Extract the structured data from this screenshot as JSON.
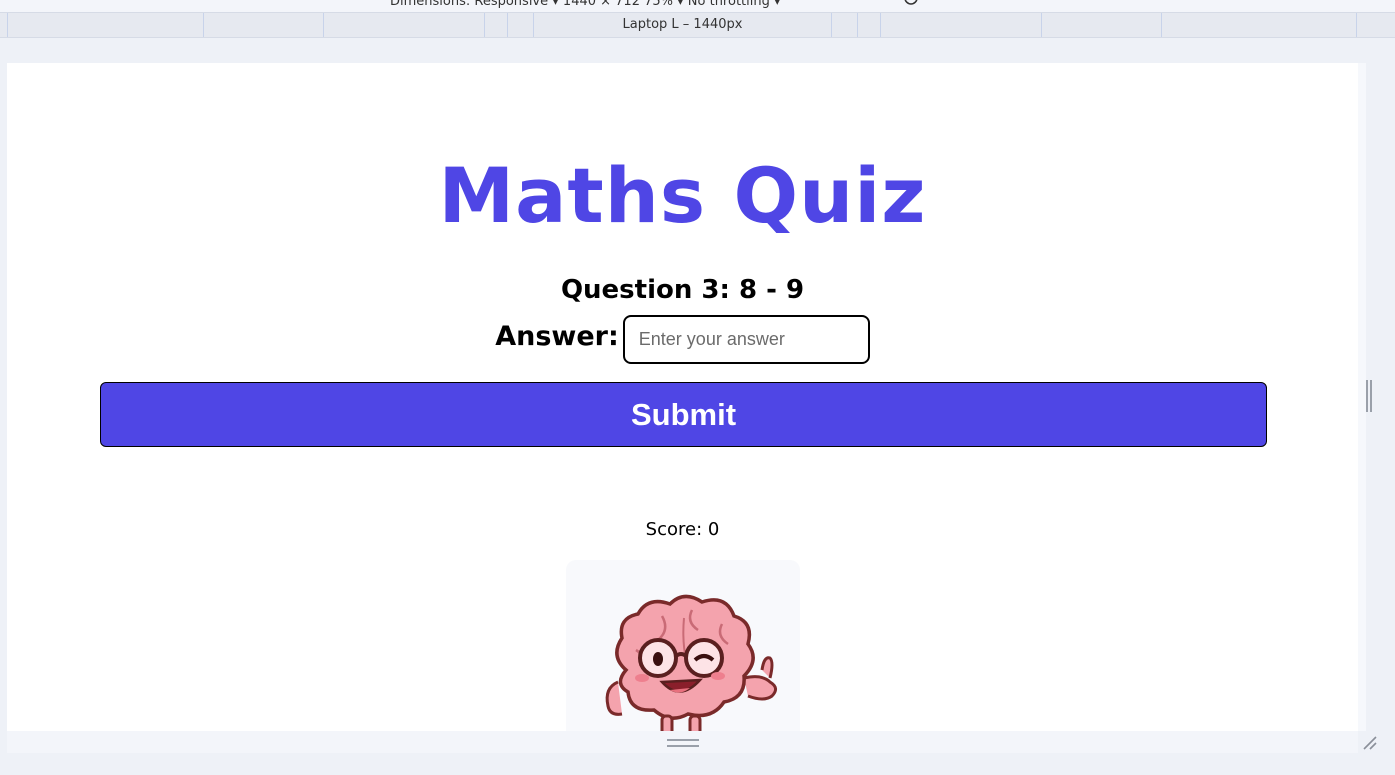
{
  "devtools": {
    "toolbar_text": "Dimensions: Responsive ▾    1440  ×  712     75% ▾    No throttling ▾",
    "ruler_label": "Laptop L – 1440px"
  },
  "quiz": {
    "title": "Maths Quiz",
    "question": "Question 3: 8 - 9",
    "answer_label": "Answer:",
    "answer_placeholder": "Enter your answer",
    "answer_value": "",
    "submit_label": "Submit",
    "score_text": "Score: 0"
  },
  "colors": {
    "accent": "#4f46e5",
    "brain_pink": "#f4a3ad",
    "outline": "#7a2a2a"
  },
  "icons": {
    "mascot": "brain-mascot-thumbs-up"
  }
}
